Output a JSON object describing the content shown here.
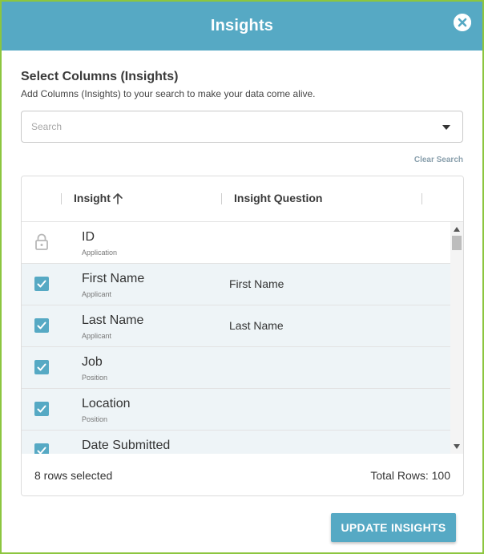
{
  "dialog": {
    "title": "Insights",
    "close_icon": "close-circle-icon"
  },
  "section": {
    "title": "Select Columns (Insights)",
    "subtitle": "Add Columns (Insights) to your search to make your data come alive."
  },
  "search": {
    "placeholder": "Search",
    "value": "",
    "dropdown_icon": "caret-down-icon",
    "clear_label": "Clear Search"
  },
  "table": {
    "columns": [
      {
        "label": "Insight",
        "sort": "ascending",
        "sort_icon": "arrow-up-icon"
      },
      {
        "label": "Insight Question"
      }
    ],
    "rows": [
      {
        "name": "ID",
        "category": "Application",
        "question": "",
        "state": "locked",
        "icon": "lock-icon"
      },
      {
        "name": "First Name",
        "category": "Applicant",
        "question": "First Name",
        "state": "checked",
        "icon": "checkbox-checked-icon"
      },
      {
        "name": "Last Name",
        "category": "Applicant",
        "question": "Last Name",
        "state": "checked",
        "icon": "checkbox-checked-icon"
      },
      {
        "name": "Job",
        "category": "Position",
        "question": "",
        "state": "checked",
        "icon": "checkbox-checked-icon"
      },
      {
        "name": "Location",
        "category": "Position",
        "question": "",
        "state": "checked",
        "icon": "checkbox-checked-icon"
      },
      {
        "name": "Date Submitted",
        "category": "",
        "question": "",
        "state": "checked",
        "icon": "checkbox-checked-icon"
      }
    ],
    "footer": {
      "selected_text": "8 rows selected",
      "total_text": "Total Rows: 100"
    }
  },
  "actions": {
    "update_label": "UPDATE INSIGHTS"
  },
  "colors": {
    "accent": "#56a9c4",
    "border_outline": "#8cc63f",
    "selected_row_bg": "#eef4f7"
  }
}
